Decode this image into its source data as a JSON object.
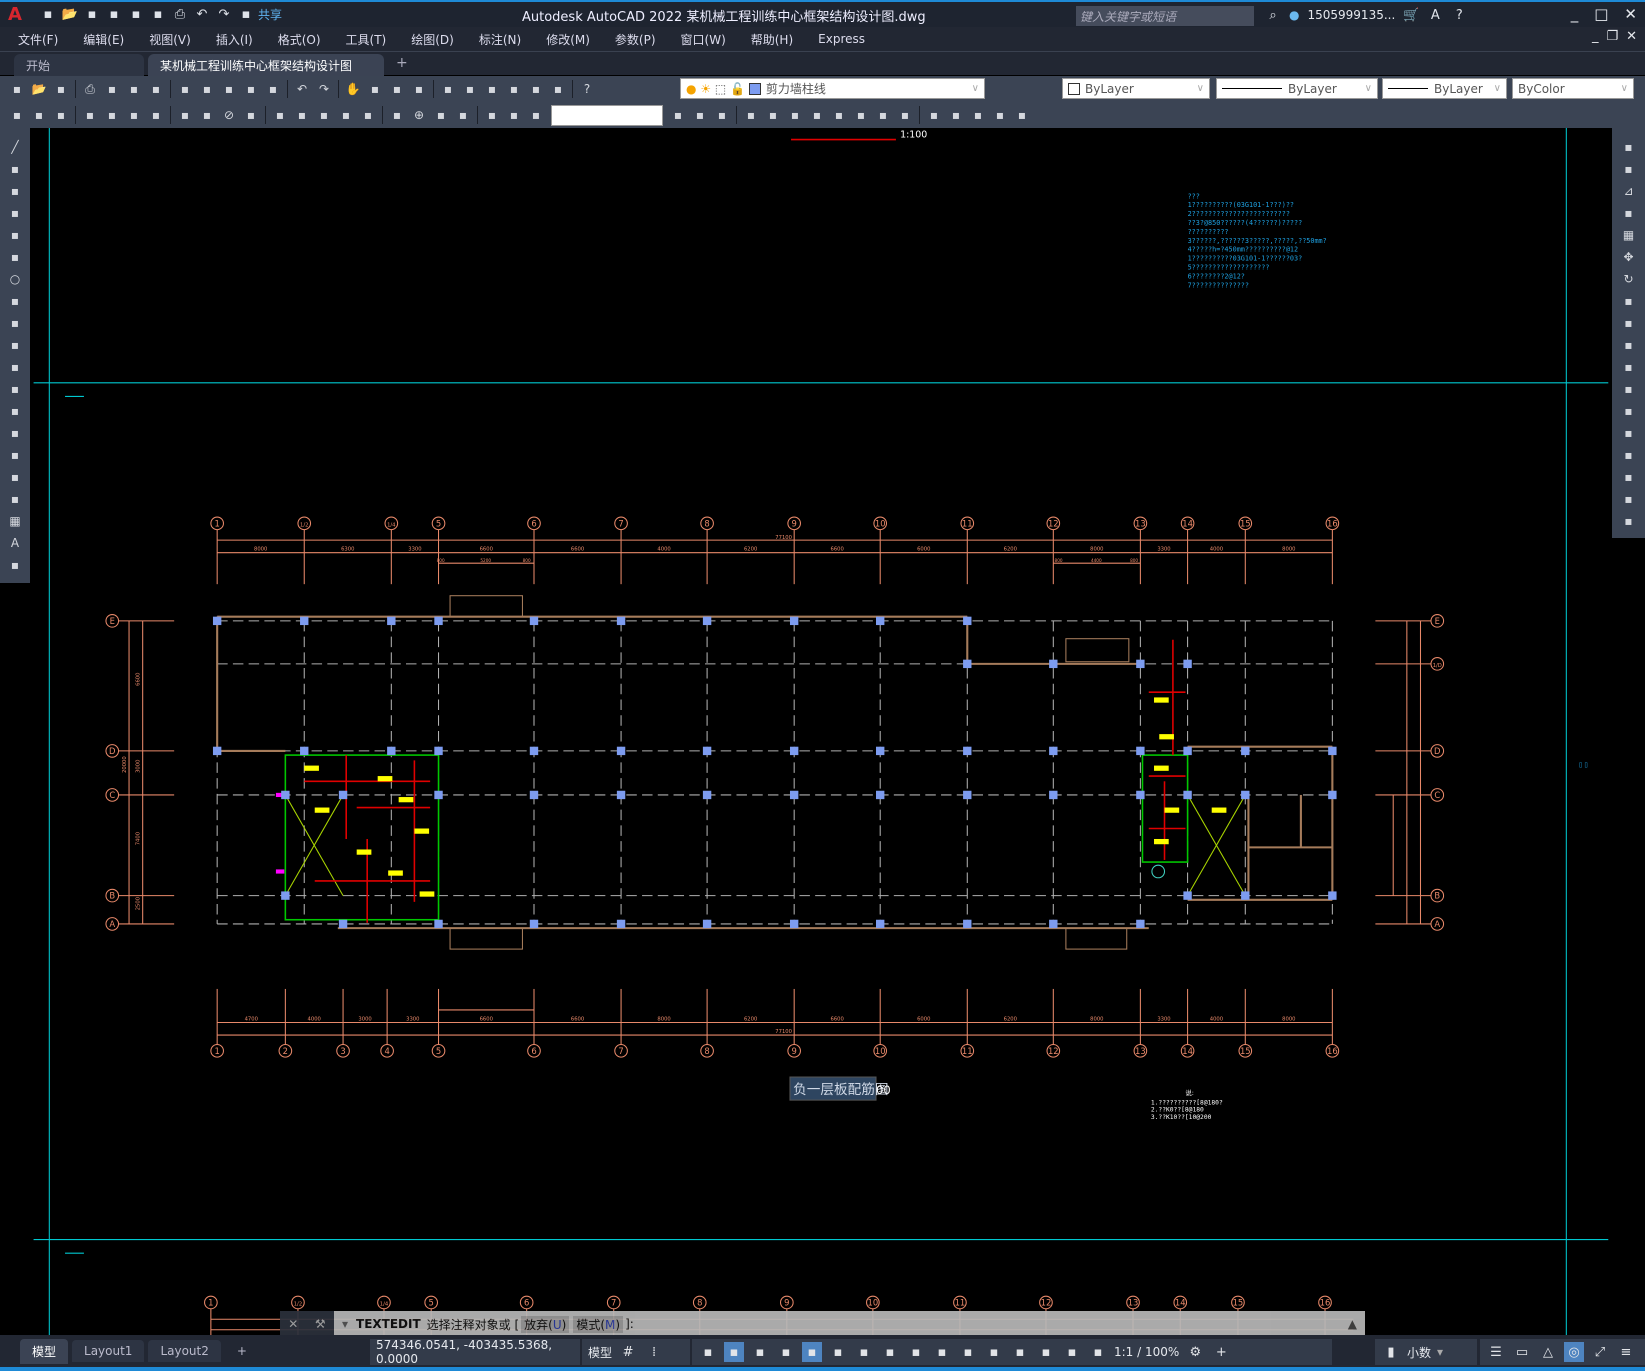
{
  "titlebar": {
    "app_title": "Autodesk AutoCAD 2022    某机械工程训练中心框架结构设计图.dwg",
    "share_label": "共享",
    "search_placeholder": "键入关键字或短语",
    "user": "1505999135...",
    "quick_access_icons": [
      "new-icon",
      "open-icon",
      "save-icon",
      "save-as-icon",
      "open-web-icon",
      "save-web-icon",
      "plot-icon",
      "undo-icon",
      "redo-icon",
      "customize-icon"
    ]
  },
  "menu": [
    "文件(F)",
    "编辑(E)",
    "视图(V)",
    "插入(I)",
    "格式(O)",
    "工具(T)",
    "绘图(D)",
    "标注(N)",
    "修改(M)",
    "参数(P)",
    "窗口(W)",
    "帮助(H)",
    "Express"
  ],
  "tabs": {
    "home": "开始",
    "active": "某机械工程训练中心框架结构设计图*",
    "plus": "+"
  },
  "toolbar1_icons": [
    "qnew-icon",
    "open-icon",
    "save-icon",
    "|",
    "plot-icon",
    "preview-icon",
    "publish-icon",
    "3dprint-icon",
    "|",
    "cut-icon",
    "copy-icon",
    "paste-icon",
    "match-properties-icon",
    "block-editor-icon",
    "|",
    "undo-icon",
    "redo-icon",
    "|",
    "pan-icon",
    "zoom-realtime-icon",
    "zoom-window-icon",
    "zoom-previous-icon",
    "|",
    "properties-icon",
    "design-center-icon",
    "tool-palettes-icon",
    "sheet-set-icon",
    "markup-icon",
    "calculator-icon",
    "|",
    "help-icon"
  ],
  "toolbar2_icons": [
    "layer-properties-icon",
    "layer-state-icon",
    "layer-previous-icon",
    "|",
    "linear-dim-icon",
    "aligned-dim-icon",
    "arc-length-icon",
    "ordinate-icon",
    "|",
    "radius-icon",
    "jogged-icon",
    "diameter-icon",
    "angular-icon",
    "|",
    "quick-dim-icon",
    "baseline-icon",
    "continue-icon",
    "dim-space-icon",
    "dim-break-icon",
    "|",
    "tolerance-icon",
    "center-mark-icon",
    "inspection-icon",
    "jogged-linear-icon",
    "|",
    "dim-edit-icon",
    "dim-text-edit-icon",
    "dim-update-icon"
  ],
  "toolbar2b_icons": [
    "union-icon",
    "subtract-icon",
    "intersect-icon",
    "|",
    "extrude-faces-icon",
    "move-faces-icon",
    "offset-faces-icon",
    "delete-faces-icon",
    "rotate-faces-icon",
    "taper-faces-icon",
    "copy-faces-icon",
    "color-faces-icon",
    "|",
    "imprint-icon",
    "clean-icon",
    "separate-icon",
    "shell-icon",
    "check-icon"
  ],
  "layer": {
    "name": "剪力墙柱线",
    "swatch": "#7d9cf0"
  },
  "properties": {
    "color": "ByLayer",
    "linetype": "ByLayer",
    "lineweight": "ByLayer",
    "plotstyle": "ByColor"
  },
  "left_tools": [
    "line-icon",
    "xline-icon",
    "polyline-icon",
    "polygon-icon",
    "rectangle-icon",
    "arc-icon",
    "circle-icon",
    "revcloud-icon",
    "spline-icon",
    "ellipse-icon",
    "ellipse-arc-icon",
    "insert-block-icon",
    "make-block-icon",
    "point-icon",
    "hatch-icon",
    "gradient-icon",
    "region-icon",
    "table-icon",
    "mtext-icon",
    "add-selected-icon"
  ],
  "right_tools": [
    "erase-icon",
    "copy-icon",
    "mirror-icon",
    "offset-icon",
    "array-icon",
    "move-icon",
    "rotate-icon",
    "scale-icon",
    "stretch-icon",
    "trim-icon",
    "extend-icon",
    "break-at-point-icon",
    "break-icon",
    "join-icon",
    "chamfer-icon",
    "fillet-icon",
    "blend-icon",
    "explode-icon"
  ],
  "drawing": {
    "scale_label_top": "1:100",
    "title": "负一层板配筋图",
    "title_suffix": "00",
    "top_axes": [
      "1",
      "1/2",
      "1/4",
      "5",
      "6",
      "7",
      "8",
      "9",
      "10",
      "11",
      "12",
      "13",
      "14",
      "15",
      "16"
    ],
    "bottom_axes": [
      "1",
      "2",
      "3",
      "4",
      "5",
      "6",
      "7",
      "8",
      "9",
      "10",
      "11",
      "12",
      "13",
      "14",
      "15",
      "16"
    ],
    "left_rows": [
      "E",
      "D",
      "C",
      "B",
      "A"
    ],
    "right_rows": [
      "E",
      "1/D",
      "D",
      "C",
      "B",
      "A"
    ],
    "top_dims": [
      "8000",
      "6300",
      "3300",
      "6600",
      "6600",
      "4000",
      "6200",
      "6600",
      "6000",
      "6200",
      "8000",
      "3300",
      "4000",
      "8000"
    ],
    "top_total": "77100",
    "top_sub_dims": [
      "800",
      "5200",
      "800",
      "800",
      "4400",
      "800"
    ],
    "bottom_dims": [
      "4700",
      "4000",
      "3000",
      "3300",
      "6600",
      "6600",
      "8000",
      "6200",
      "6600",
      "6000",
      "6200",
      "8000",
      "3300",
      "4000",
      "8000"
    ],
    "bottom_total": "77100",
    "left_dims": [
      "6600",
      "3000",
      "7400",
      "2500"
    ],
    "left_total": "20000",
    "notes_cyan": [
      "???",
      "1??????????(03G101-1???)??",
      "2????????????????????????",
      "  ??3?@850??????(4??????)?????",
      "  ??????????",
      "3??????,??????3?????,?????,??50mm?",
      "4?????h=?450mm??????????@12",
      "  1??????????03G101-1??????03?",
      "5???????????????????",
      "6????????2@12?",
      "7??????????????"
    ],
    "notes_white_header": "说:",
    "notes_white": [
      "1.??????????[8@180?",
      "2.??K0??[8@180",
      "3.??K10??[10@200"
    ]
  },
  "command": {
    "name": "TEXTEDIT",
    "prompt": "选择注释对象或 [",
    "opt1": "放弃(",
    "opt1_key": "U",
    "opt1_end": ")",
    "opt2": "模式(",
    "opt2_key": "M",
    "opt2_end": ")",
    "tail": "]:"
  },
  "status": {
    "tabs": [
      "模型",
      "Layout1",
      "Layout2"
    ],
    "add_tab": "+",
    "coords": "574346.0541, -403435.5368, 0.0000",
    "space": "模型",
    "annotation_scale": "1:1 / 100%",
    "units": "小数"
  },
  "colors": {
    "axis": "#e8896a",
    "wall": "#a67c5b",
    "grid": "#b0b0b0",
    "column": "#7d9cf0",
    "green": "#00c800",
    "yellow": "#ffff00",
    "red": "#e00000",
    "cyan": "#00c8d0"
  }
}
